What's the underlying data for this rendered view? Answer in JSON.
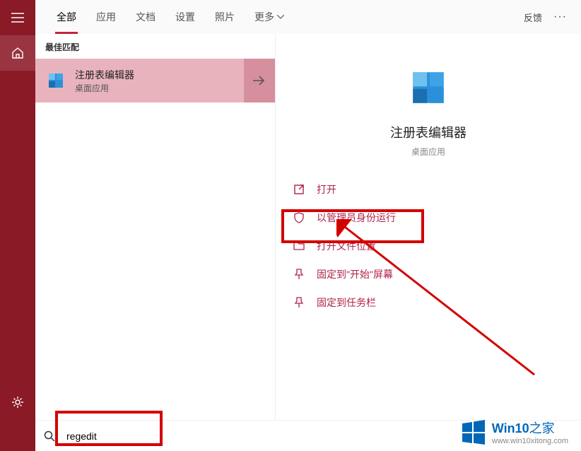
{
  "rail": {
    "hamburger": "menu-icon",
    "home": "home-icon",
    "settings": "settings-icon"
  },
  "tabs": {
    "items": [
      "全部",
      "应用",
      "文档",
      "设置",
      "照片",
      "更多"
    ],
    "active": 0,
    "feedback": "反馈",
    "more_chevron": "▾"
  },
  "results": {
    "section_label": "最佳匹配",
    "best": {
      "title": "注册表编辑器",
      "subtitle": "桌面应用",
      "icon": "registry-icon",
      "arrow": "→"
    }
  },
  "detail": {
    "title": "注册表编辑器",
    "subtitle": "桌面应用",
    "actions": [
      {
        "icon": "open-icon",
        "label": "打开"
      },
      {
        "icon": "admin-icon",
        "label": "以管理员身份运行"
      },
      {
        "icon": "folder-icon",
        "label": "打开文件位置"
      },
      {
        "icon": "pin-start-icon",
        "label": "固定到\"开始\"屏幕"
      },
      {
        "icon": "pin-task-icon",
        "label": "固定到任务栏"
      }
    ]
  },
  "search": {
    "value": "regedit",
    "placeholder": "regedit"
  },
  "watermark": {
    "brand_en": "Win10",
    "brand_zh": "之家",
    "url": "www.win10xitong.com"
  },
  "colors": {
    "rail": "#8a1a26",
    "result_bg": "#e9b3bd",
    "result_arrow_bg": "#d68f9d",
    "accent": "#c22548",
    "annotation": "#d40000",
    "windows": "#0067b8"
  }
}
